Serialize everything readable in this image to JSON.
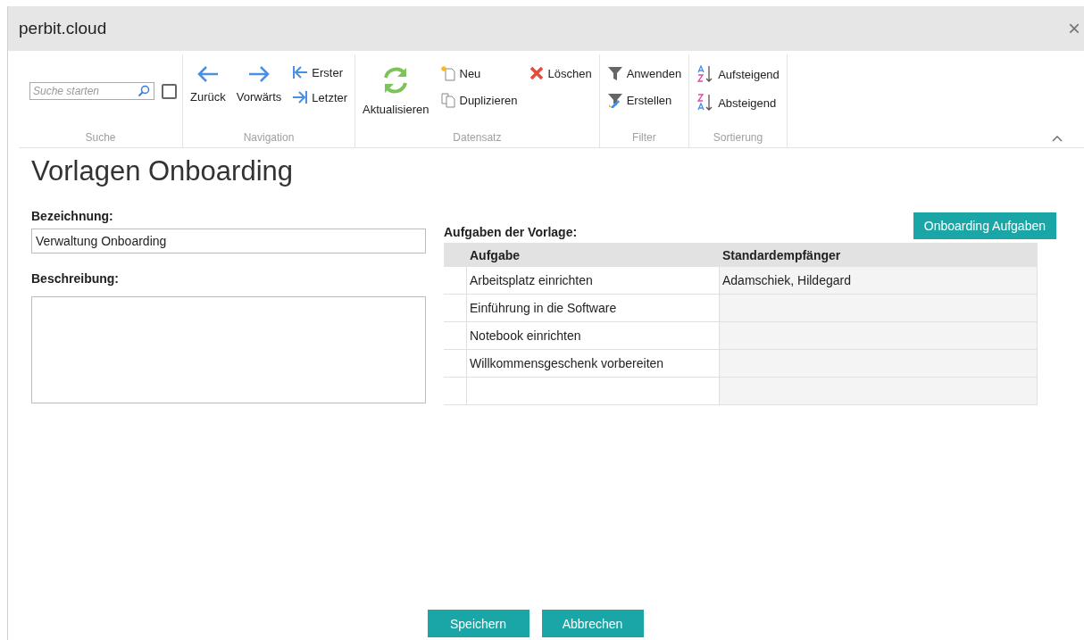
{
  "window": {
    "title": "perbit.cloud",
    "close": "×"
  },
  "ribbon": {
    "groups": [
      {
        "label": "Suche",
        "columns": [
          [
            {
              "kind": "search",
              "placeholder": "Suche starten"
            }
          ],
          [
            {
              "kind": "checkbox",
              "checked": false
            }
          ]
        ]
      },
      {
        "label": "Navigation",
        "columns": [
          [
            {
              "kind": "large",
              "label": "Zurück"
            }
          ],
          [
            {
              "kind": "large",
              "label": "Vorwärts"
            }
          ],
          [
            {
              "kind": "small",
              "label": "Erster"
            },
            {
              "kind": "small",
              "label": "Letzter"
            }
          ]
        ]
      },
      {
        "label": "Datensatz",
        "columns": [
          [
            {
              "kind": "large",
              "label": "Aktualisieren"
            }
          ],
          [
            {
              "kind": "small",
              "label": "Neu"
            },
            {
              "kind": "small",
              "label": "Duplizieren"
            }
          ],
          [
            {
              "kind": "small",
              "label": "Löschen"
            }
          ]
        ]
      },
      {
        "label": "Filter",
        "columns": [
          [
            {
              "kind": "small",
              "label": "Anwenden"
            },
            {
              "kind": "small",
              "label": "Erstellen"
            }
          ]
        ]
      },
      {
        "label": "Sortierung",
        "columns": [
          [
            {
              "kind": "small",
              "label": "Aufsteigend"
            },
            {
              "kind": "small",
              "label": "Absteigend"
            }
          ]
        ]
      }
    ],
    "collapsed": false
  },
  "page": {
    "title": "Vorlagen Onboarding"
  },
  "form": {
    "name_label": "Bezeichnung:",
    "name_value": "Verwaltung Onboarding",
    "description_label": "Beschreibung:"
  },
  "tasks": {
    "label": "Aufgaben der Vorlage:",
    "button": "Onboarding Aufgaben",
    "columns": [
      "Aufgabe",
      "Standardempfänger"
    ],
    "rows": [
      {
        "task": "Arbeitsplatz einrichten",
        "recipient": "Adamschiek, Hildegard"
      },
      {
        "task": "Einführung in die Software"
      },
      {
        "task": "Notebook einrichten"
      },
      {
        "task": "Willkommensgeschenk vorbereiten"
      }
    ]
  },
  "footer": {
    "buttons": [
      "Speichern",
      "Abbrechen"
    ]
  }
}
